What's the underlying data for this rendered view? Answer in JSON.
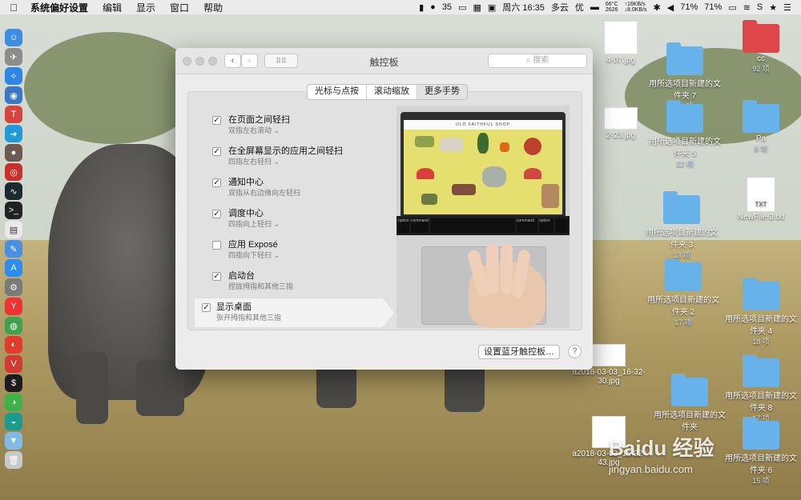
{
  "menubar": {
    "apple": "",
    "items": [
      "系统偏好设置",
      "编辑",
      "显示",
      "窗口",
      "帮助"
    ],
    "status": {
      "wechat_count": "35",
      "datetime": "周六 16:35",
      "weather": "多云",
      "quality": "优",
      "cpu_temp": "66°C",
      "cpu_num": "2626",
      "net_up": "↑16KB/s",
      "net_down": "↓8.0KB/s",
      "battery1": "71%",
      "battery2": "71%"
    }
  },
  "window": {
    "title": "触控板",
    "search_placeholder": "搜索",
    "tabs": [
      {
        "label": "光标与点按"
      },
      {
        "label": "滚动缩放"
      },
      {
        "label": "更多手势",
        "active": true
      }
    ],
    "options": [
      {
        "label": "在页面之间轻扫",
        "sub": "双指左右滚动",
        "checked": true
      },
      {
        "label": "在全屏幕显示的应用之间轻扫",
        "sub": "四指左右轻扫",
        "checked": true
      },
      {
        "label": "通知中心",
        "sub": "双指从右边缘向左轻扫",
        "checked": true
      },
      {
        "label": "调度中心",
        "sub": "四指向上轻扫",
        "checked": true
      },
      {
        "label": "应用 Exposé",
        "sub": "四指向下轻扫",
        "checked": false
      },
      {
        "label": "启动台",
        "sub": "捏拢拇指和其他三指",
        "checked": true
      },
      {
        "label": "显示桌面",
        "sub": "张开拇指和其他三指",
        "checked": true,
        "selected": true
      }
    ],
    "preview": {
      "site_title": "OLD FAITHFUL SHOP",
      "key_labels": [
        "option",
        "command",
        "command",
        "option"
      ]
    },
    "bluetooth_button": "设置蓝牙触控板…",
    "help": "?"
  },
  "desktop": {
    "icons": [
      {
        "name": "a2018-03-02_23-4-07.jpg",
        "short": "4-07.jpg"
      },
      {
        "name": "用所选项目新建的文件夹 7",
        "count": "16 项"
      },
      {
        "name": "cc",
        "count": "92 项"
      },
      {
        "name": "a2018-03-03_16-32-23.jpg",
        "short": "2-23.jpg"
      },
      {
        "name": "用所选项目新建的文件夹 5",
        "count": "12 项"
      },
      {
        "name": "Pa",
        "count": "8 项"
      },
      {
        "name": "NewFile-3.txt"
      },
      {
        "name": "用所选项目新建的文件夹 3",
        "count": "13 项"
      },
      {
        "name": "用所选项目新建的文件夹 2",
        "count": "17 项"
      },
      {
        "name": "用所选项目新建的文件夹 4",
        "count": "18 项"
      },
      {
        "name": "a2018-03-03_16-32-30.jpg"
      },
      {
        "name": "用所选项目新建的文件夹",
        "count": "17 项"
      },
      {
        "name": "用所选项目新建的文件夹 8",
        "count": "17 项"
      },
      {
        "name": "a2018-03-03_16-32-43.jpg"
      },
      {
        "name": "用所选项目新建的文件夹 6",
        "count": "15 项"
      }
    ]
  },
  "watermark": {
    "text": "Baidu 经验",
    "url": "jingyan.baidu.com"
  },
  "colors": {
    "folder": "#67b2ea",
    "folder_red": "#e0454a",
    "link_blue": "#2e7ae6"
  }
}
